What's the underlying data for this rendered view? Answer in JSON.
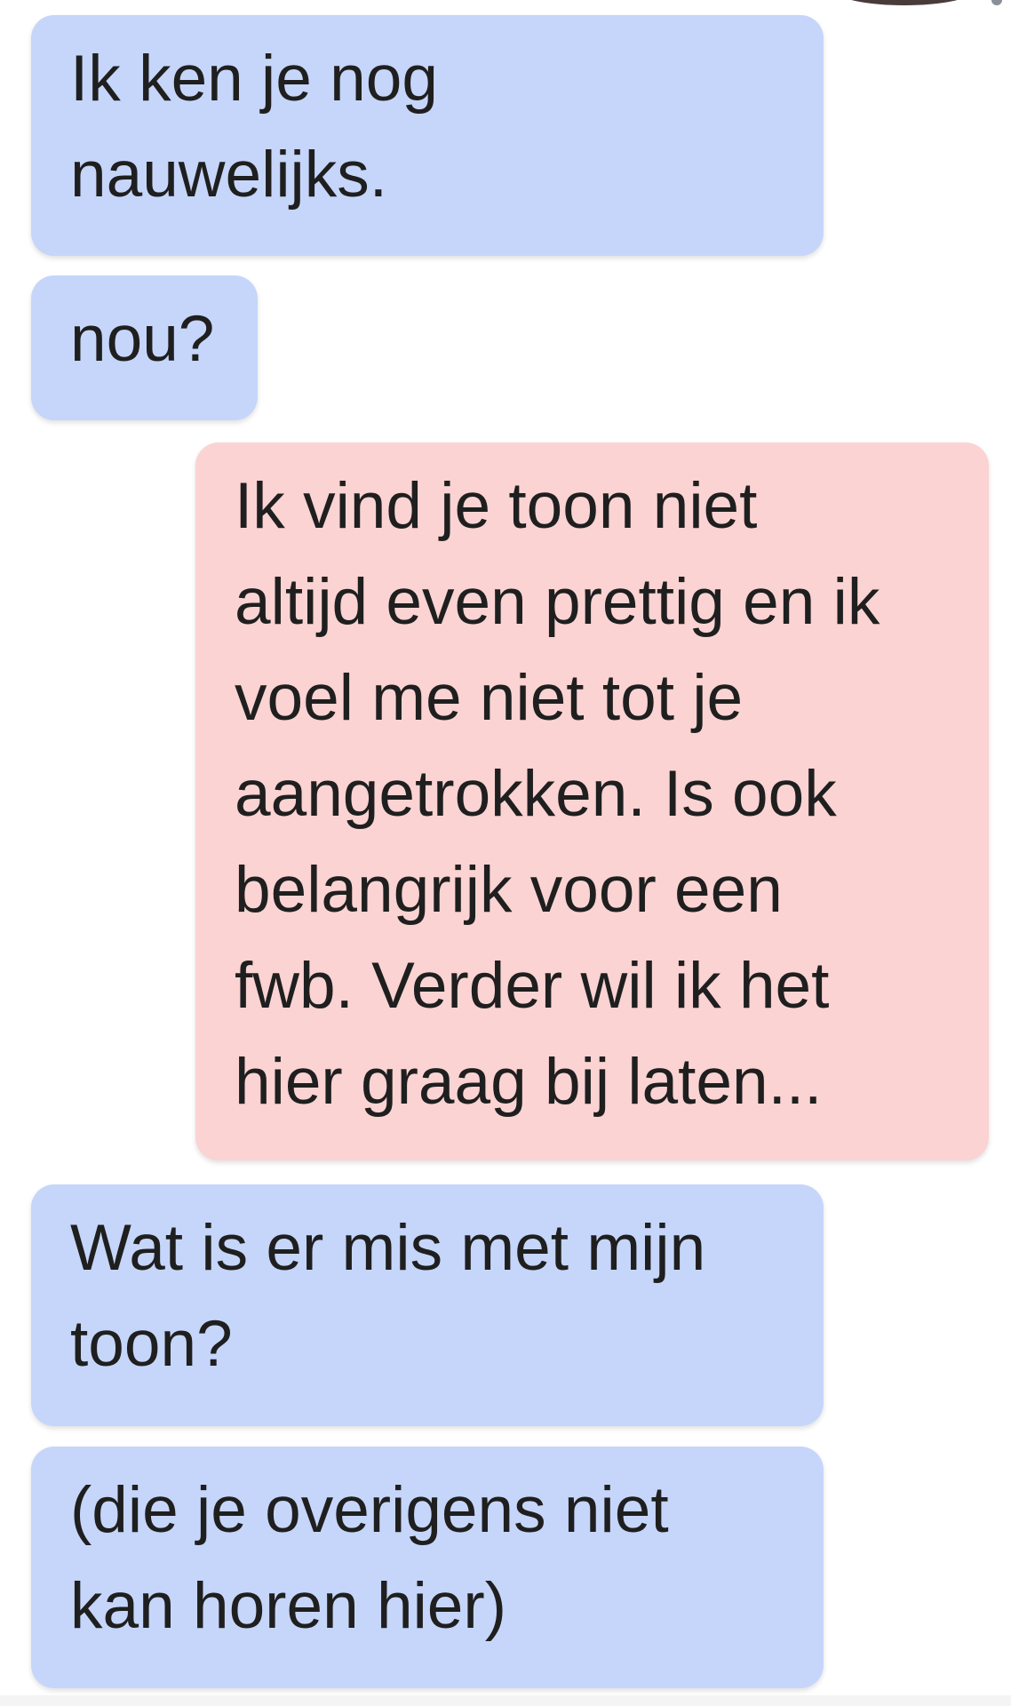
{
  "conversation": {
    "messages": [
      {
        "direction": "incoming",
        "text": "Ik ken je nog\nnauwelijks."
      },
      {
        "direction": "incoming",
        "text": "nou?"
      },
      {
        "direction": "outgoing",
        "text": "Ik vind je toon niet\naltijd even prettig en ik\nvoel me niet tot je\naangetrokken. Is ook\nbelangrijk voor een\nfwb. Verder wil ik het\nhier graag bij laten..."
      },
      {
        "direction": "incoming",
        "text": "Wat is er mis met mijn\ntoon?"
      },
      {
        "direction": "incoming",
        "text": "(die je overigens niet\nkan horen hier)"
      }
    ]
  },
  "colors": {
    "incoming_bubble": "#c6d6fa",
    "outgoing_bubble": "#fbd3d3",
    "text": "#1f1f1f",
    "background": "#ffffff"
  }
}
